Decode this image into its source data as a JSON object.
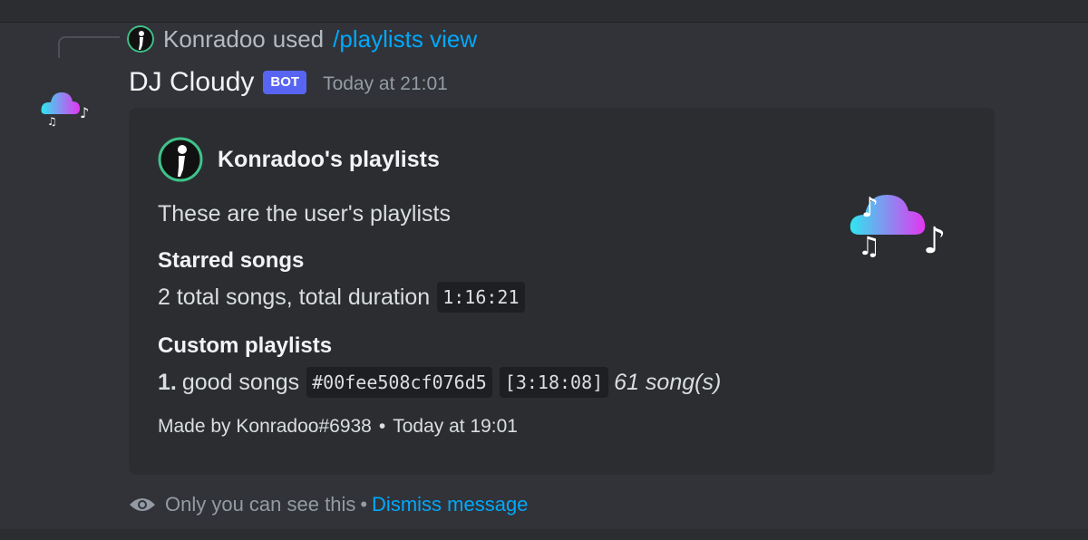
{
  "reply": {
    "user": "Konradoo",
    "used_text": "used",
    "command": "/playlists view"
  },
  "message": {
    "username": "DJ Cloudy",
    "badge": "BOT",
    "timestamp": "Today at 21:01"
  },
  "embed": {
    "author": "Konradoo's playlists",
    "description": "These are the user's playlists",
    "fields": [
      {
        "name": "Starred songs",
        "value_text": "2 total songs, total duration",
        "duration": "1:16:21"
      },
      {
        "name": "Custom playlists",
        "item_number": "1.",
        "item_name": "good songs",
        "item_id": "#00fee508cf076d5",
        "item_duration": "[3:18:08]",
        "item_count": "61 song(s)"
      }
    ],
    "footer": {
      "text": "Made by Konradoo#6938",
      "separator": "•",
      "time": "Today at 19:01"
    }
  },
  "ephemeral": {
    "text": "Only you can see this",
    "separator": "•",
    "dismiss": "Dismiss message"
  },
  "icons": {
    "user_avatar": "user-avatar-icon",
    "bot_avatar": "cloud-music-icon",
    "eye": "eye-icon"
  },
  "colors": {
    "background": "#313338",
    "embed": "#2b2d31",
    "link": "#00a8fc",
    "badge": "#5865f2",
    "muted": "#949ba4"
  }
}
